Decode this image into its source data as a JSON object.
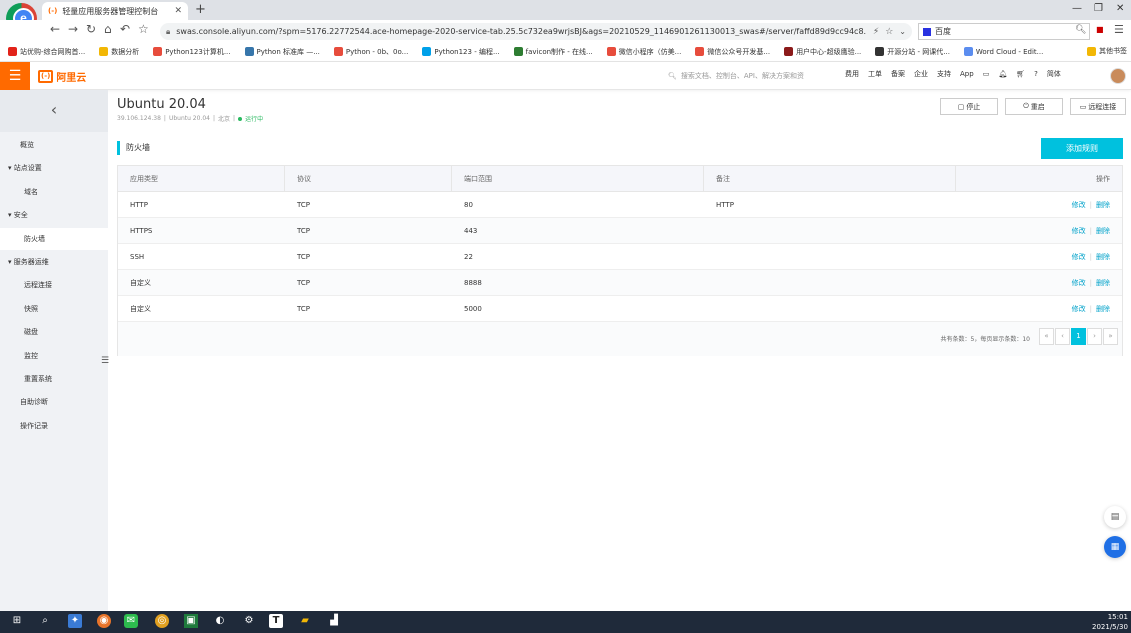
{
  "browser": {
    "tab_icon": "(-)",
    "tab_title": "轻量应用服务器管理控制台",
    "url": "swas.console.aliyun.com/?spm=5176.22772544.ace-homepage-2020-service-tab.25.5c732ea9wrjsBJ&ags=20210529_1146901261130013_swas#/server/faffd89d9cc94c8...",
    "search_engine": "百度",
    "bookmarks": [
      {
        "label": "站优购-综合网购首...",
        "color": "#e2231a"
      },
      {
        "label": "数据分析",
        "color": "#f2b705"
      },
      {
        "label": "Python123计算机...",
        "color": "#e74c3c"
      },
      {
        "label": "Python 标准库 —...",
        "color": "#3776ab"
      },
      {
        "label": "Python - 0b、0o...",
        "color": "#e74c3c"
      },
      {
        "label": "Python123 - 编程...",
        "color": "#00a0e9"
      },
      {
        "label": "favicon制作 - 在线...",
        "color": "#2e7d32"
      },
      {
        "label": "微信小程序（仿美...",
        "color": "#e74c3c"
      },
      {
        "label": "微信公众号开发基...",
        "color": "#e74c3c"
      },
      {
        "label": "用户中心-超级鹰验...",
        "color": "#8b1a1a"
      },
      {
        "label": "开源分站 - 网课代...",
        "color": "#333333"
      },
      {
        "label": "Word Cloud - Edit...",
        "color": "#5b8def"
      }
    ],
    "other_bookmarks": "其他书签"
  },
  "console": {
    "brand": "阿里云",
    "search_placeholder": "搜索文档、控制台、API、解决方案和资",
    "nav": [
      "费用",
      "工单",
      "备案",
      "企业",
      "支持",
      "App"
    ],
    "lang": "简体"
  },
  "sidebar": {
    "items": [
      {
        "label": "概览",
        "indent": 0,
        "arrow": false,
        "active": false
      },
      {
        "label": "站点设置",
        "indent": 0,
        "arrow": true,
        "active": false
      },
      {
        "label": "域名",
        "indent": 1,
        "arrow": false,
        "active": false
      },
      {
        "label": "安全",
        "indent": 0,
        "arrow": true,
        "active": false
      },
      {
        "label": "防火墙",
        "indent": 1,
        "arrow": false,
        "active": true
      },
      {
        "label": "服务器运维",
        "indent": 0,
        "arrow": true,
        "active": false
      },
      {
        "label": "远程连接",
        "indent": 1,
        "arrow": false,
        "active": false
      },
      {
        "label": "快照",
        "indent": 1,
        "arrow": false,
        "active": false
      },
      {
        "label": "磁盘",
        "indent": 1,
        "arrow": false,
        "active": false
      },
      {
        "label": "监控",
        "indent": 1,
        "arrow": false,
        "active": false
      },
      {
        "label": "重置系统",
        "indent": 1,
        "arrow": false,
        "active": false
      },
      {
        "label": "自助诊断",
        "indent": 0,
        "arrow": false,
        "active": false
      },
      {
        "label": "操作记录",
        "indent": 0,
        "arrow": false,
        "active": false
      }
    ]
  },
  "server": {
    "title": "Ubuntu 20.04",
    "ip": "39.106.124.38",
    "os": "Ubuntu 20.04",
    "region": "北京",
    "status": "运行中",
    "actions": [
      {
        "icon": "stop-icon",
        "label": "停止"
      },
      {
        "icon": "restart-icon",
        "label": "重启"
      },
      {
        "icon": "remote-icon",
        "label": "远程连接"
      }
    ]
  },
  "firewall": {
    "section_title": "防火墙",
    "add_label": "添加规则",
    "columns": [
      "应用类型",
      "协议",
      "端口范围",
      "备注",
      "操作"
    ],
    "rows": [
      {
        "app": "HTTP",
        "protocol": "TCP",
        "port": "80",
        "note": "HTTP"
      },
      {
        "app": "HTTPS",
        "protocol": "TCP",
        "port": "443",
        "note": ""
      },
      {
        "app": "SSH",
        "protocol": "TCP",
        "port": "22",
        "note": ""
      },
      {
        "app": "自定义",
        "protocol": "TCP",
        "port": "8888",
        "note": ""
      },
      {
        "app": "自定义",
        "protocol": "TCP",
        "port": "5000",
        "note": ""
      }
    ],
    "edit_label": "修改",
    "delete_label": "删除",
    "pagination_summary": "共有条数：5，每页显示条数：10",
    "pages": [
      "«",
      "‹",
      "1",
      "›",
      "»"
    ],
    "current_page": "1"
  },
  "taskbar": {
    "time": "15:01",
    "date": "2021/5/30"
  },
  "colors": {
    "brand": "#ff6a00",
    "accent": "#00c1de",
    "link": "#00a2ca"
  }
}
